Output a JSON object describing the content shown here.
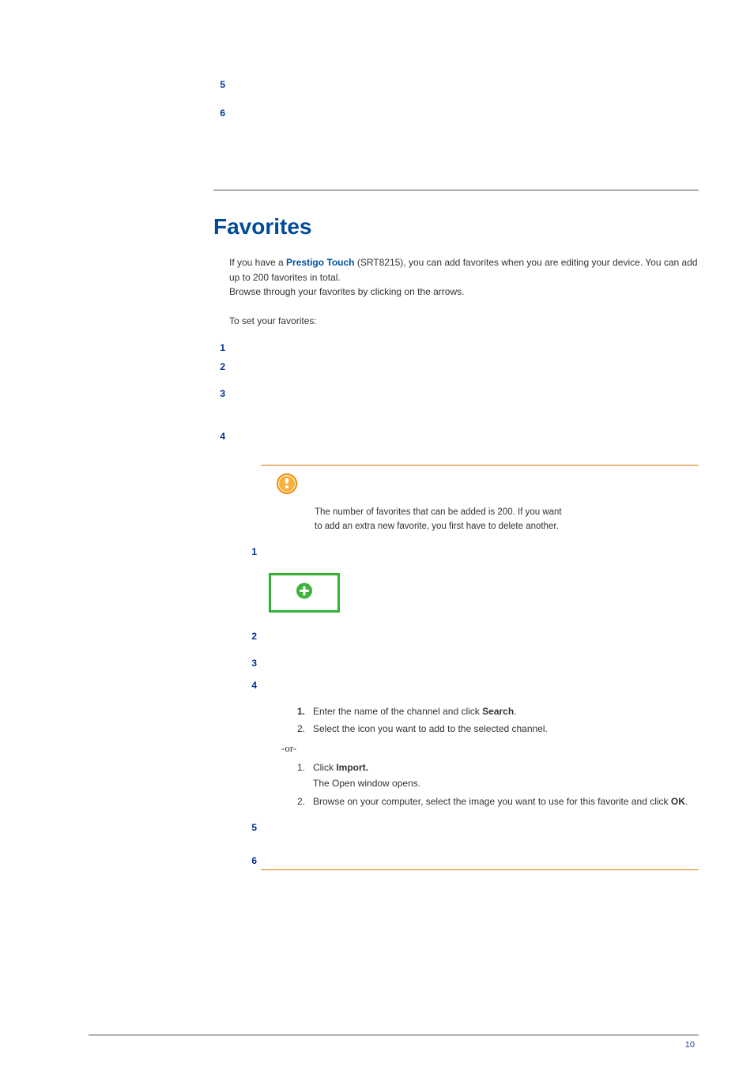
{
  "top_numbers": [
    "5",
    "6"
  ],
  "section_title": "Favorites",
  "intro": {
    "pre": "If you have a ",
    "brand": "Prestigo Touch",
    "post_brand": " (SRT8215), you can add favorites when you are editing your device. You can add up to 200 favorites in total.",
    "line2": "Browse through your favorites by clicking on the arrows.",
    "lead_in": "To set your favorites:"
  },
  "outer_steps": [
    "1",
    "2",
    "3",
    "4"
  ],
  "tip": {
    "line1": "The number of favorites that can be added is 200. If you want",
    "line2": "to add an extra new favorite, you first have to delete another."
  },
  "inner_steps": [
    "1",
    "2",
    "3",
    "4",
    "5",
    "6"
  ],
  "sublist_a": {
    "item1_pre": "Enter the name of the channel and click ",
    "item1_bold": "Search",
    "item1_post": ".",
    "item2": "Select the icon you want to add to the selected channel."
  },
  "or": "-or-",
  "sublist_b": {
    "item1_pre": "Click ",
    "item1_bold": "Import.",
    "item1_sub": "The Open window opens.",
    "item2_pre": "Browse on your computer, select the image you want to use for this favorite and click ",
    "item2_bold": "OK",
    "item2_post": "."
  },
  "page_number": "10"
}
